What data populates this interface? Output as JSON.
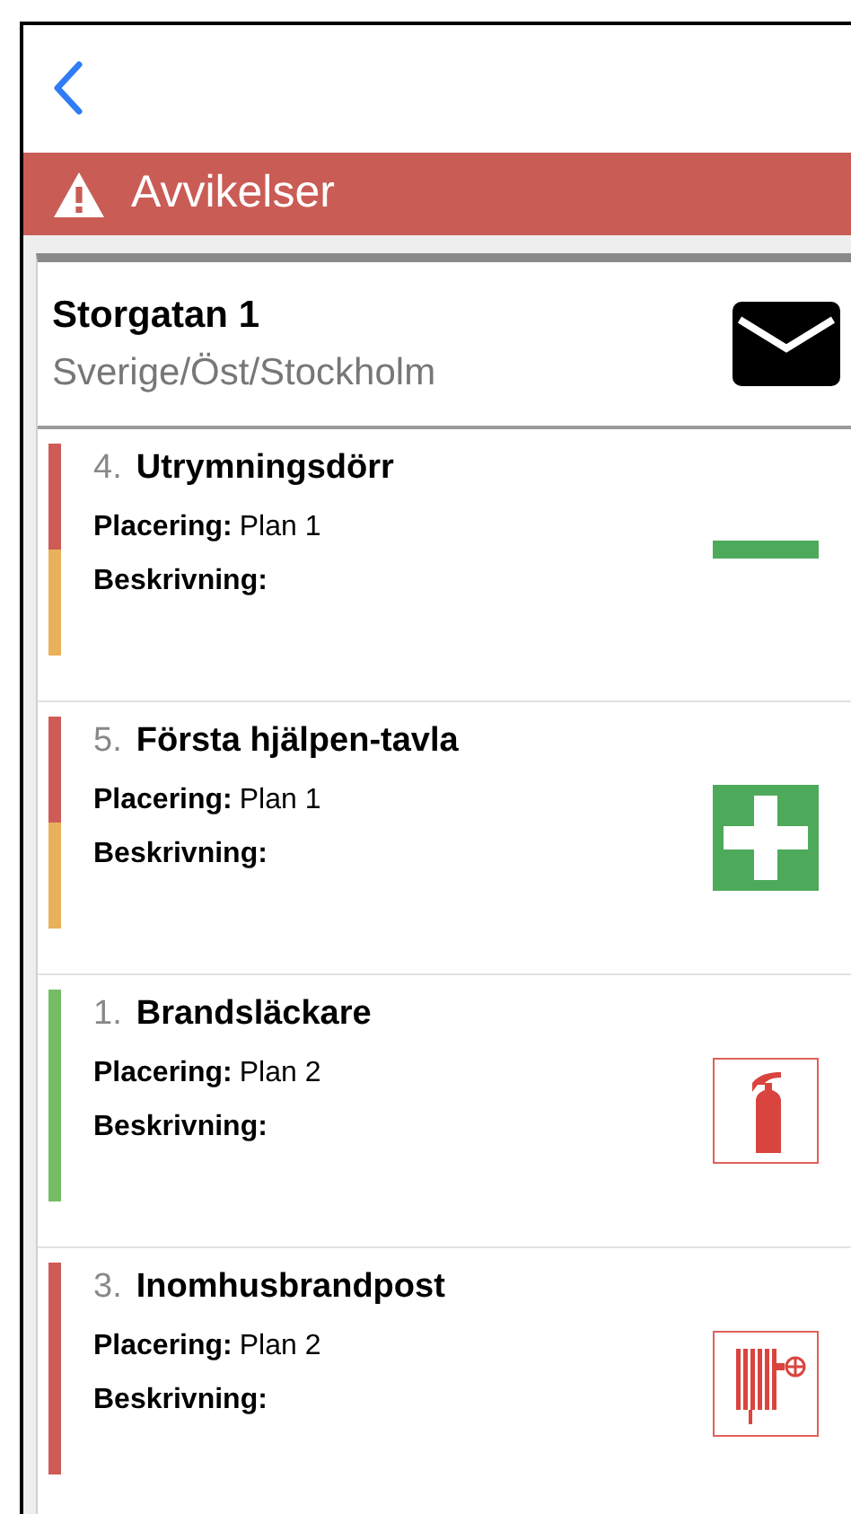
{
  "header": {
    "title": "Avvikelser"
  },
  "location": {
    "name": "Storgatan 1",
    "path": "Sverige/Öst/Stockholm"
  },
  "items": [
    {
      "number": "4.",
      "title": "Utrymningsdörr",
      "placement_label": "Placering:",
      "placement": "Plan 1",
      "description_label": "Beskrivning:",
      "kind": "exit-door",
      "status_segments": [
        {
          "color": "#cf5b56"
        },
        {
          "color": "#e8b15a"
        }
      ]
    },
    {
      "number": "5.",
      "title": "Första hjälpen-tavla",
      "placement_label": "Placering:",
      "placement": "Plan 1",
      "description_label": "Beskrivning:",
      "kind": "first-aid",
      "status_segments": [
        {
          "color": "#cf5b56"
        },
        {
          "color": "#e8b15a"
        }
      ]
    },
    {
      "number": "1.",
      "title": "Brandsläckare",
      "placement_label": "Placering:",
      "placement": "Plan 2",
      "description_label": "Beskrivning:",
      "kind": "extinguisher",
      "status_segments": [
        {
          "color": "#74bd64"
        }
      ]
    },
    {
      "number": "3.",
      "title": "Inomhusbrandpost",
      "placement_label": "Placering:",
      "placement": "Plan 2",
      "description_label": "Beskrivning:",
      "kind": "hose",
      "status_segments": [
        {
          "color": "#cf5b56"
        }
      ]
    }
  ]
}
